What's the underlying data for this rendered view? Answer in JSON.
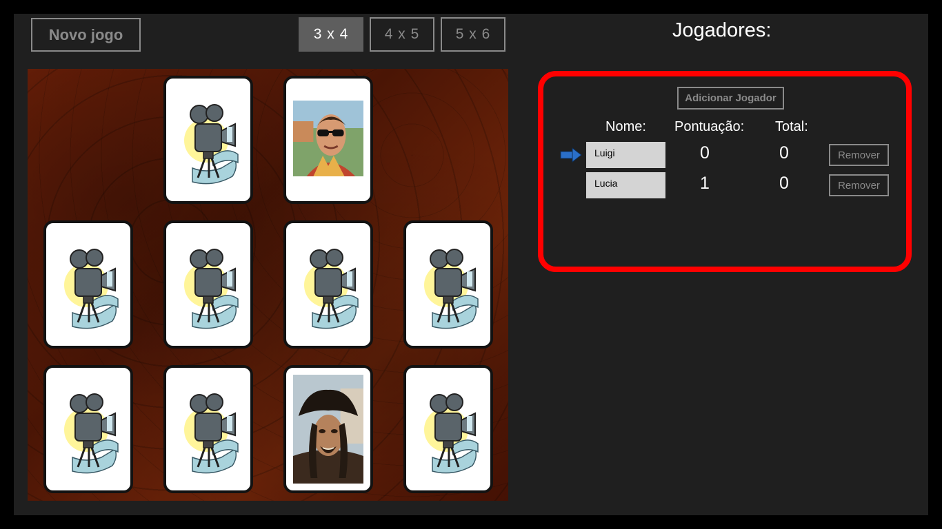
{
  "toolbar": {
    "new_game_label": "Novo jogo",
    "sizes": [
      {
        "label": "3 x 4",
        "selected": true
      },
      {
        "label": "4 x 5",
        "selected": false
      },
      {
        "label": "5 x 6",
        "selected": false
      }
    ]
  },
  "board": {
    "rows": 3,
    "columns": 4,
    "cards": [
      {
        "state": "empty"
      },
      {
        "state": "face-down",
        "icon": "film-camera-icon"
      },
      {
        "state": "face-up",
        "icon": "man-sunglasses-photo"
      },
      {
        "state": "empty"
      },
      {
        "state": "face-down",
        "icon": "film-camera-icon"
      },
      {
        "state": "face-down",
        "icon": "film-camera-icon"
      },
      {
        "state": "face-down",
        "icon": "film-camera-icon"
      },
      {
        "state": "face-down",
        "icon": "film-camera-icon"
      },
      {
        "state": "face-down",
        "icon": "film-camera-icon"
      },
      {
        "state": "face-down",
        "icon": "film-camera-icon"
      },
      {
        "state": "face-up",
        "icon": "pirate-photo"
      },
      {
        "state": "face-down",
        "icon": "film-camera-icon"
      }
    ]
  },
  "players": {
    "title": "Jogadores:",
    "add_label": "Adicionar Jogador",
    "columns": {
      "name": "Nome:",
      "score": "Pontuação:",
      "total": "Total:"
    },
    "rows": [
      {
        "name": "Luigi",
        "score": "0",
        "total": "0",
        "remove_label": "Remover",
        "current_turn": true
      },
      {
        "name": "Lucia",
        "score": "1",
        "total": "0",
        "remove_label": "Remover",
        "current_turn": false
      }
    ],
    "turn_icon": "arrow-right-icon"
  },
  "colors": {
    "background": "#1f1f1f",
    "panel_border": "#ff0000",
    "selected_size": "#5e5e5e",
    "turn_arrow": "#2a6fc9"
  }
}
